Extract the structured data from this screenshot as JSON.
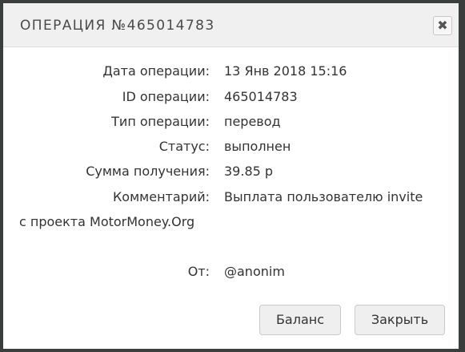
{
  "dialog": {
    "title": "Операция №465014783",
    "close_glyph": "✖"
  },
  "fields": {
    "date": {
      "label": "Дата операции:",
      "value": "13 Янв 2018 15:16"
    },
    "id": {
      "label": "ID операции:",
      "value": "465014783"
    },
    "type": {
      "label": "Тип операции:",
      "value": "перевод"
    },
    "status": {
      "label": "Статус:",
      "value": "выполнен"
    },
    "amount": {
      "label": "Сумма получения:",
      "value": "39.85 р"
    },
    "comment": {
      "label": "Комментарий:",
      "value": "Выплата пользователю invite",
      "continuation": "с проекта MotorMoney.Org"
    },
    "from": {
      "label": "От:",
      "value": "@anonim"
    }
  },
  "buttons": {
    "balance": "Баланс",
    "close": "Закрыть"
  }
}
